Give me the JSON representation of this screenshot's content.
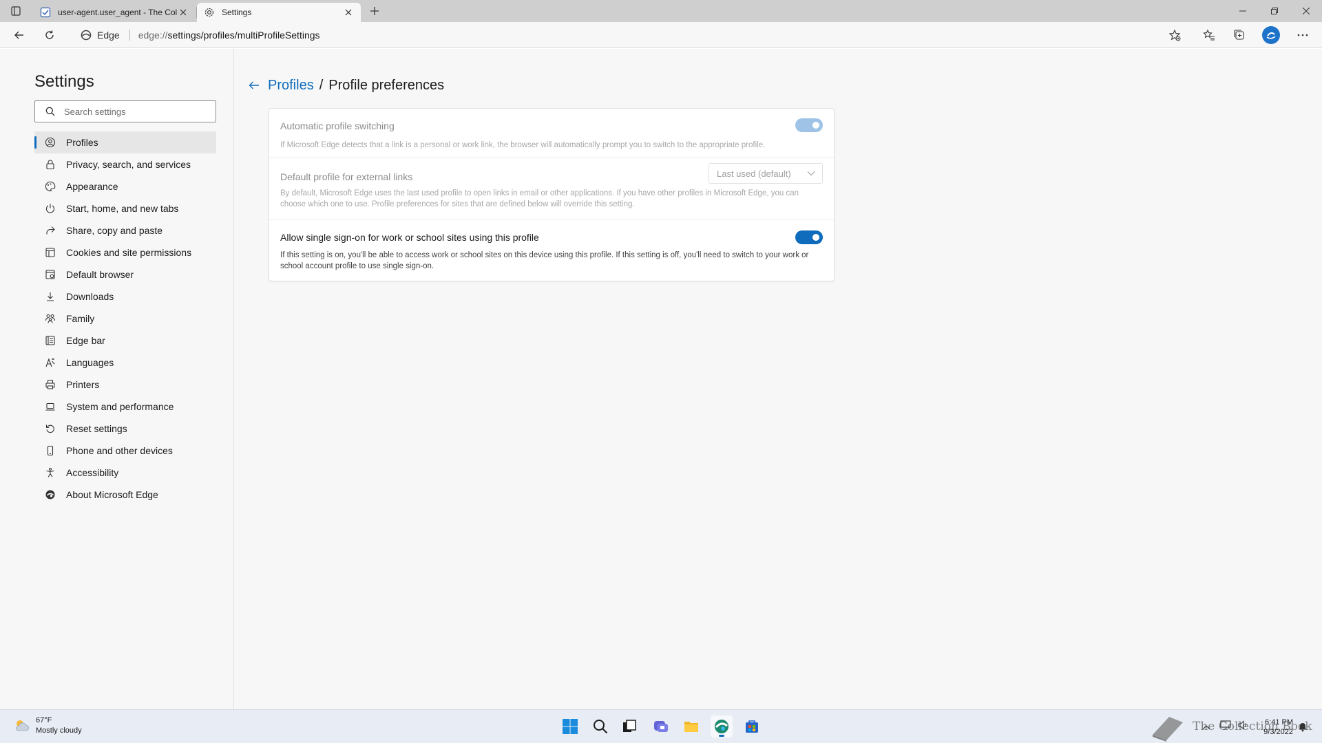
{
  "browser": {
    "tabs": [
      {
        "title": "user-agent.user_agent - The Coll",
        "active": false
      },
      {
        "title": "Settings",
        "active": true
      }
    ],
    "address": {
      "site_name": "Edge",
      "url_scheme": "edge://",
      "url_path": "settings/profiles/multiProfileSettings"
    }
  },
  "sidebar": {
    "title": "Settings",
    "search_placeholder": "Search settings",
    "items": [
      {
        "label": "Profiles",
        "icon": "profile-icon",
        "selected": true
      },
      {
        "label": "Privacy, search, and services",
        "icon": "lock-icon"
      },
      {
        "label": "Appearance",
        "icon": "appearance-icon"
      },
      {
        "label": "Start, home, and new tabs",
        "icon": "power-icon"
      },
      {
        "label": "Share, copy and paste",
        "icon": "share-icon"
      },
      {
        "label": "Cookies and site permissions",
        "icon": "cookies-icon"
      },
      {
        "label": "Default browser",
        "icon": "browser-icon"
      },
      {
        "label": "Downloads",
        "icon": "download-icon"
      },
      {
        "label": "Family",
        "icon": "family-icon"
      },
      {
        "label": "Edge bar",
        "icon": "edge-bar-icon"
      },
      {
        "label": "Languages",
        "icon": "languages-icon"
      },
      {
        "label": "Printers",
        "icon": "printer-icon"
      },
      {
        "label": "System and performance",
        "icon": "laptop-icon"
      },
      {
        "label": "Reset settings",
        "icon": "reset-icon"
      },
      {
        "label": "Phone and other devices",
        "icon": "phone-icon"
      },
      {
        "label": "Accessibility",
        "icon": "accessibility-icon"
      },
      {
        "label": "About Microsoft Edge",
        "icon": "edge-logo-icon"
      }
    ]
  },
  "main": {
    "breadcrumb": {
      "parent": "Profiles",
      "separator": "/",
      "current": "Profile preferences"
    },
    "settings": [
      {
        "title": "Automatic profile switching",
        "description": "If Microsoft Edge detects that a link is a personal or work link, the browser will automatically prompt you to switch to the appropriate profile.",
        "control": "toggle",
        "enabled": true,
        "disabled": true
      },
      {
        "title": "Default profile for external links",
        "description": "By default, Microsoft Edge uses the last used profile to open links in email or other applications. If you have other profiles in Microsoft Edge, you can choose which one to use. Profile preferences for sites that are defined below will override this setting.",
        "control": "select",
        "value": "Last used (default)",
        "disabled": true
      },
      {
        "title": "Allow single sign-on for work or school sites using this profile",
        "description": "If this setting is on, you'll be able to access work or school sites on this device using this profile. If this setting is off, you'll need to switch to your work or school account profile to use single sign-on.",
        "control": "toggle",
        "enabled": true,
        "disabled": false
      }
    ]
  },
  "taskbar": {
    "weather": {
      "temp": "67°F",
      "condition": "Mostly cloudy"
    },
    "clock": {
      "time": "6:41 PM",
      "date": "9/3/2022"
    },
    "watermark": "The Collection Book"
  },
  "colors": {
    "accent": "#0f6cbd",
    "accent_disabled": "#9ec3e6"
  }
}
